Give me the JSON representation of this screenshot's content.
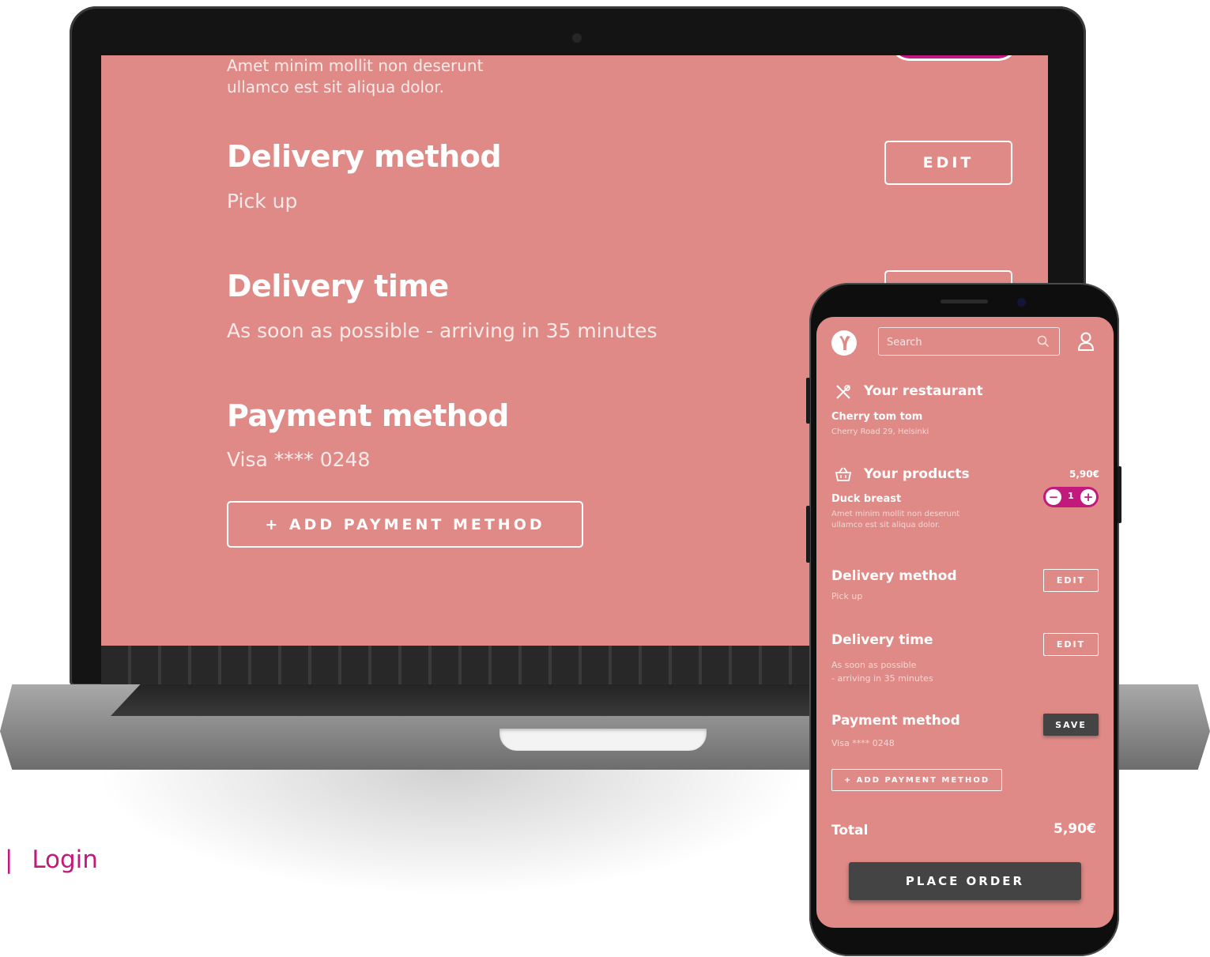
{
  "laptop": {
    "description_line1": "Amet minim mollit non deserunt",
    "description_line2": "ullamco est sit aliqua dolor.",
    "delivery_method": {
      "title": "Delivery method",
      "value": "Pick up",
      "edit_label": "EDIT"
    },
    "delivery_time": {
      "title": "Delivery time",
      "value": "As soon as possible - arriving in 35 minutes"
    },
    "payment_method": {
      "title": "Payment method",
      "value": "Visa **** 0248",
      "add_label": "+ ADD PAYMENT METHOD"
    }
  },
  "footer": {
    "separator": "|",
    "login_label": "Login"
  },
  "phone": {
    "search": {
      "placeholder": "Search"
    },
    "restaurant": {
      "title": "Your restaurant",
      "name": "Cherry tom tom",
      "address": "Cherry Road 29, Helsinki"
    },
    "products": {
      "title": "Your products",
      "price": "5,90€",
      "item_name": "Duck breast",
      "item_desc_line1": "Amet minim mollit non deserunt",
      "item_desc_line2": "ullamco est sit aliqua dolor.",
      "quantity": "1",
      "minus": "−",
      "plus": "+"
    },
    "delivery_method": {
      "title": "Delivery method",
      "value": "Pick up",
      "edit_label": "EDIT"
    },
    "delivery_time": {
      "title": "Delivery time",
      "value_line1": "As soon as possible",
      "value_line2": "- arriving in 35 minutes",
      "edit_label": "EDIT"
    },
    "payment_method": {
      "title": "Payment method",
      "value": "Visa **** 0248",
      "save_label": "SAVE",
      "add_label": "+ ADD PAYMENT METHOD"
    },
    "total": {
      "label": "Total",
      "value": "5,90€"
    },
    "place_order_label": "PLACE ORDER"
  },
  "colors": {
    "screen_bg": "#df8a86",
    "accent": "#c2197c",
    "button_dark": "#444444"
  },
  "icons": [
    "search-icon",
    "user-icon",
    "restaurant-icon",
    "basket-icon",
    "brand-logo"
  ]
}
